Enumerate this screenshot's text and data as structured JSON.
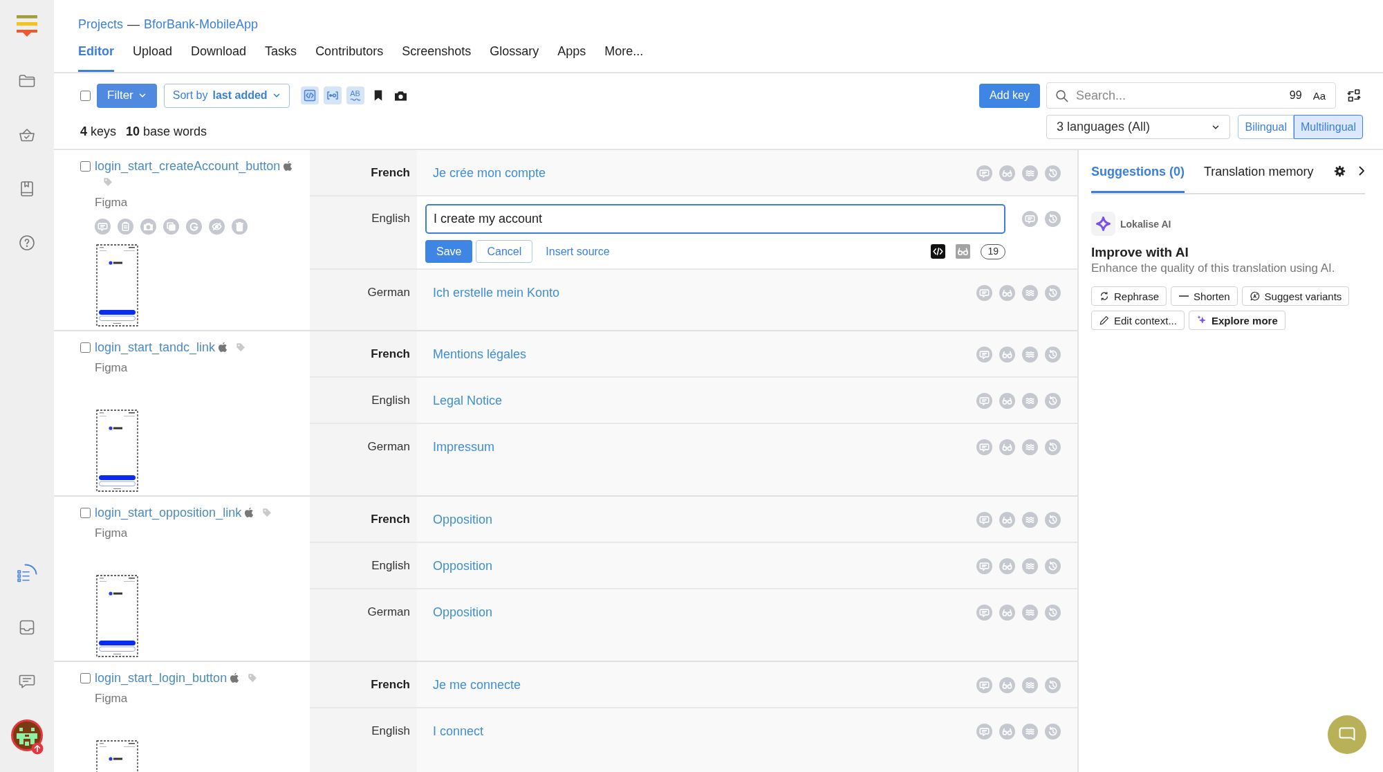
{
  "sidebar": {
    "top_items": [
      {
        "selected": false
      },
      {
        "selected": false
      },
      {
        "selected": false
      },
      {
        "selected": false
      }
    ],
    "bottom_items": [
      {
        "selected": true
      },
      {
        "selected": false
      },
      {
        "selected": false
      }
    ]
  },
  "breadcrumb": {
    "items": [
      "Projects",
      "BforBank-MobileApp"
    ],
    "separator": "—"
  },
  "tabs": [
    {
      "label": "Editor",
      "selected": true
    },
    {
      "label": "Upload",
      "selected": false
    },
    {
      "label": "Download",
      "selected": false
    },
    {
      "label": "Tasks",
      "selected": false
    },
    {
      "label": "Contributors",
      "selected": false
    },
    {
      "label": "Screenshots",
      "selected": false
    },
    {
      "label": "Glossary",
      "selected": false
    },
    {
      "label": "Apps",
      "selected": false
    },
    {
      "label": "More...",
      "selected": false
    }
  ],
  "toolbar": {
    "select_all_checked": false,
    "filter_button": "Filter",
    "sort_button": "Sort by **last added**",
    "view_toggles": [
      {
        "on": true
      },
      {
        "on": true
      },
      {
        "label": "AB",
        "on": true
      }
    ],
    "summary": [
      "**4** keys",
      "**10** base words"
    ],
    "add_key_button": "Add key",
    "search": {
      "placeholder": "Search...",
      "count": "99",
      "case_button": "Aa"
    },
    "languages_dropdown": "3 languages (All)",
    "view_modes": [
      {
        "label": "Bilingual",
        "selected": false
      },
      {
        "label": "Multilingual",
        "selected": true
      }
    ]
  },
  "keys": [
    {
      "name": "login_start_createAccount_button",
      "checked": false,
      "source": "Figma",
      "actions_shown": true,
      "translations": [
        {
          "language": "French",
          "base": true,
          "editing": false,
          "text": "Je crée mon compte"
        },
        {
          "language": "English",
          "base": false,
          "editing": true,
          "text": "I create my account",
          "editor": {
            "save": "Save",
            "cancel": "Cancel",
            "insert_source": "Insert source",
            "char_count": "19"
          }
        },
        {
          "language": "German",
          "base": false,
          "editing": false,
          "text": "Ich erstelle mein Konto"
        }
      ]
    },
    {
      "name": "login_start_tandc_link",
      "checked": false,
      "source": "Figma",
      "actions_shown": false,
      "translations": [
        {
          "language": "French",
          "base": true,
          "editing": false,
          "text": "Mentions légales"
        },
        {
          "language": "English",
          "base": false,
          "editing": false,
          "text": "Legal Notice"
        },
        {
          "language": "German",
          "base": false,
          "editing": false,
          "text": "Impressum"
        }
      ]
    },
    {
      "name": "login_start_opposition_link",
      "checked": false,
      "source": "Figma",
      "actions_shown": false,
      "translations": [
        {
          "language": "French",
          "base": true,
          "editing": false,
          "text": "Opposition"
        },
        {
          "language": "English",
          "base": false,
          "editing": false,
          "text": "Opposition"
        },
        {
          "language": "German",
          "base": false,
          "editing": false,
          "text": "Opposition"
        }
      ]
    },
    {
      "name": "login_start_login_button",
      "checked": false,
      "source": "Figma",
      "actions_shown": false,
      "translations": [
        {
          "language": "French",
          "base": true,
          "editing": false,
          "text": "Je me connecte"
        },
        {
          "language": "English",
          "base": false,
          "editing": false,
          "text": "I connect"
        }
      ]
    }
  ],
  "side_panel": {
    "tabs": [
      {
        "label": "Suggestions (0)",
        "selected": true
      },
      {
        "label": "Translation memory",
        "selected": false
      }
    ],
    "ai": {
      "brand": "Lokalise AI",
      "title": "Improve with AI",
      "description": "Enhance the quality of this translation using AI.",
      "actions": [
        {
          "label": "Rephrase",
          "highlighted": false
        },
        {
          "label": "Shorten",
          "highlighted": false
        },
        {
          "label": "Suggest variants",
          "highlighted": false
        },
        {
          "label": "Edit context...",
          "highlighted": false
        },
        {
          "label": "Explore more",
          "highlighted": true
        }
      ]
    }
  }
}
